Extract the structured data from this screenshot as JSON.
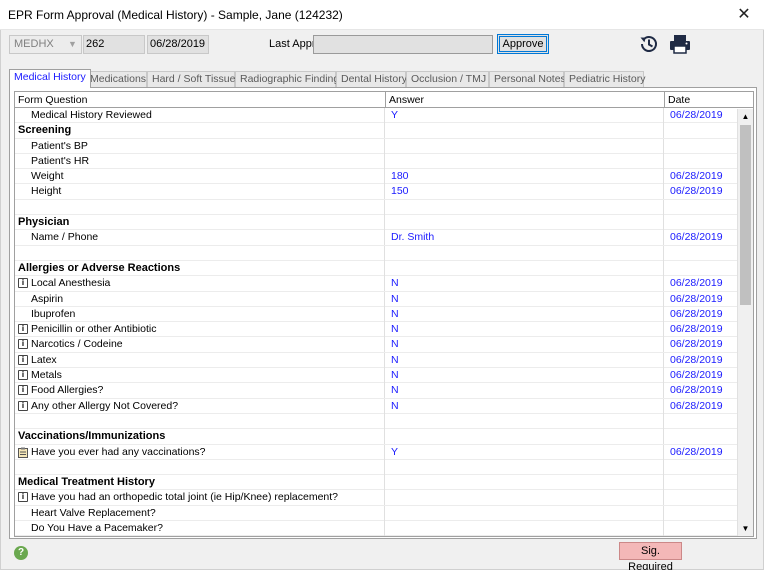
{
  "window": {
    "title": "EPR Form Approval (Medical History) - Sample, Jane (124232)",
    "close_glyph": "✕"
  },
  "toolbar": {
    "form_select_value": "MEDHX",
    "form_id": "262",
    "form_date": "06/28/2019",
    "last_appr_label": "Last Appr.",
    "last_appr_value": "",
    "approve_label": "Approve",
    "history_icon": "history-icon",
    "print_icon": "printer-icon"
  },
  "tabs": [
    {
      "label": "Medical History",
      "active": true
    },
    {
      "label": "Medications"
    },
    {
      "label": "Hard / Soft Tissue"
    },
    {
      "label": "Radiographic Finding"
    },
    {
      "label": "Dental History"
    },
    {
      "label": "Occlusion / TMJ"
    },
    {
      "label": "Personal Notes"
    },
    {
      "label": "Pediatric History"
    }
  ],
  "grid": {
    "columns": [
      "Form Question",
      "Answer",
      "Date"
    ],
    "rows": [
      {
        "type": "item",
        "question": "Medical History Reviewed",
        "answer": "Y",
        "date": "06/28/2019"
      },
      {
        "type": "section",
        "question": "Screening"
      },
      {
        "type": "item",
        "question": "Patient's BP",
        "answer": "",
        "date": ""
      },
      {
        "type": "item",
        "question": "Patient's HR",
        "answer": "",
        "date": ""
      },
      {
        "type": "item",
        "question": "Weight",
        "answer": "180",
        "date": "06/28/2019"
      },
      {
        "type": "item",
        "question": "Height",
        "answer": "150",
        "date": "06/28/2019"
      },
      {
        "type": "blank"
      },
      {
        "type": "section",
        "question": "Physician"
      },
      {
        "type": "item",
        "question": "Name / Phone",
        "answer": "Dr. Smith",
        "date": "06/28/2019"
      },
      {
        "type": "blank"
      },
      {
        "type": "section",
        "question": "Allergies or Adverse Reactions"
      },
      {
        "type": "item",
        "icon": "info",
        "question": "Local Anesthesia",
        "answer": "N",
        "date": "06/28/2019"
      },
      {
        "type": "item",
        "question": "Aspirin",
        "answer": "N",
        "date": "06/28/2019"
      },
      {
        "type": "item",
        "question": "Ibuprofen",
        "answer": "N",
        "date": "06/28/2019"
      },
      {
        "type": "item",
        "icon": "info",
        "question": "Penicillin or other Antibiotic",
        "answer": "N",
        "date": "06/28/2019"
      },
      {
        "type": "item",
        "icon": "info",
        "question": "Narcotics / Codeine",
        "answer": "N",
        "date": "06/28/2019"
      },
      {
        "type": "item",
        "icon": "info",
        "question": "Latex",
        "answer": "N",
        "date": "06/28/2019"
      },
      {
        "type": "item",
        "icon": "info",
        "question": "Metals",
        "answer": "N",
        "date": "06/28/2019"
      },
      {
        "type": "item",
        "icon": "info",
        "question": "Food Allergies?",
        "answer": "N",
        "date": "06/28/2019"
      },
      {
        "type": "item",
        "icon": "info",
        "question": "Any other Allergy Not Covered?",
        "answer": "N",
        "date": "06/28/2019"
      },
      {
        "type": "blank"
      },
      {
        "type": "section",
        "question": "Vaccinations/Immunizations"
      },
      {
        "type": "item",
        "icon": "note",
        "question": "Have you ever had any vaccinations?",
        "answer": "Y",
        "date": "06/28/2019"
      },
      {
        "type": "blank"
      },
      {
        "type": "section",
        "question": "Medical Treatment History"
      },
      {
        "type": "item",
        "icon": "info",
        "question": "Have you had an orthopedic total joint (ie Hip/Knee) replacement?",
        "answer": "",
        "date": ""
      },
      {
        "type": "item",
        "question": "Heart Valve Replacement?",
        "answer": "",
        "date": ""
      },
      {
        "type": "item",
        "question": "Do You Have a Pacemaker?",
        "answer": "",
        "date": ""
      }
    ]
  },
  "status": {
    "help_icon": "help-icon",
    "signature_badge": "Sig. Required"
  },
  "colors": {
    "answer_text": "#1a1aff",
    "sig_required_bg": "#f4b8b8",
    "active_tab_text": "#1a1aff"
  }
}
